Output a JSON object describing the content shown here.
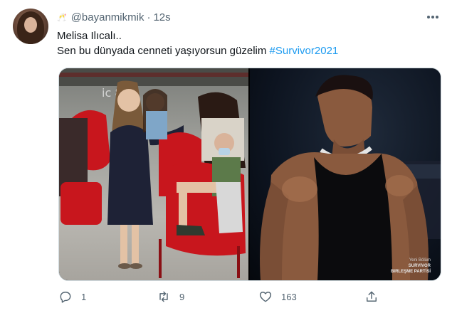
{
  "tweet": {
    "handle": "@bayanmikmik",
    "separator": "·",
    "time": "12s",
    "name_emoji": "🥂",
    "text_line1": "Melisa Ilıcalı..",
    "text_line2_plain": "Sen bu dünyada cenneti yaşıyorsun güzelim ",
    "hashtag": "#Survivor2021",
    "media_watermark_line1": "Yeni Bölüm",
    "media_watermark_line2": "SURVIVOR",
    "media_watermark_line3": "BIRLEŞME PARTİSİ"
  },
  "actions": {
    "reply_count": "1",
    "retweet_count": "9",
    "like_count": "163"
  },
  "colors": {
    "accent": "#1d9bf0",
    "secondary_text": "#536471",
    "primary_text": "#0f1419",
    "border": "#cfd9de"
  },
  "icons": {
    "more": "more-horizontal-icon",
    "reply": "reply-bubble-icon",
    "retweet": "retweet-icon",
    "like": "heart-icon",
    "share": "share-upload-icon"
  }
}
